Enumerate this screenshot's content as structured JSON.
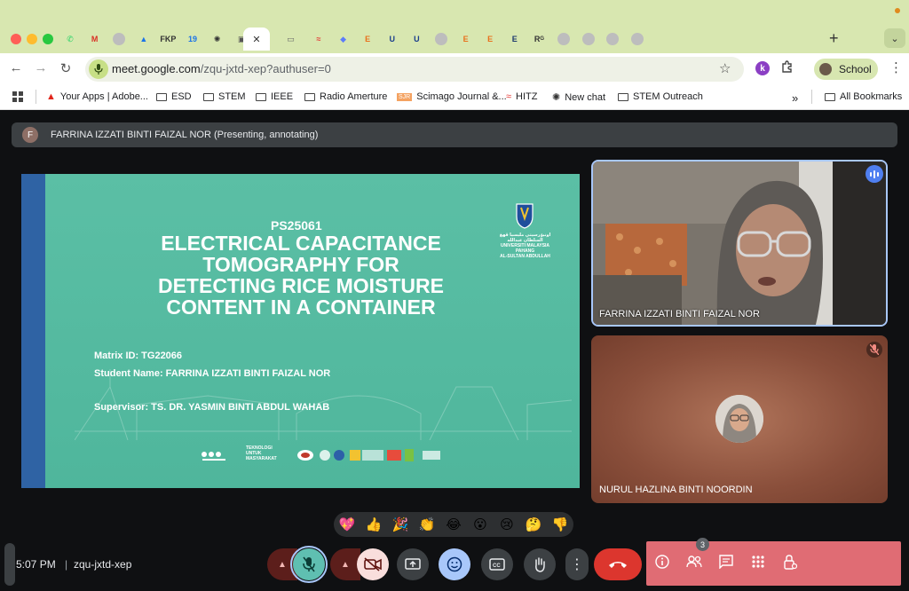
{
  "browser": {
    "tabs": [
      {
        "icon": "whatsapp-icon",
        "glyph": "✆",
        "color": "#25d366"
      },
      {
        "icon": "gmail-icon",
        "glyph": "M",
        "color": "#d93025"
      },
      {
        "icon": "generic-tab-icon",
        "glyph": "",
        "color": "#bdbdbd"
      },
      {
        "icon": "google-drive-icon",
        "glyph": "▲",
        "color": "#1a73e8"
      },
      {
        "icon": "fkp-tab-icon",
        "glyph": "FKP",
        "color": "#333333"
      },
      {
        "icon": "calendar-icon",
        "glyph": "19",
        "color": "#1a73e8"
      },
      {
        "icon": "chatgpt-icon",
        "glyph": "✺",
        "color": "#333333"
      },
      {
        "icon": "classroom-icon",
        "glyph": "▣",
        "color": "#555555"
      },
      {
        "icon": "gear-tab-icon",
        "glyph": "✹",
        "color": "#3b5998"
      },
      {
        "icon": "site-tab-icon",
        "glyph": "▭",
        "color": "#666666"
      },
      {
        "icon": "hitz-icon",
        "glyph": "≈",
        "color": "#e53935"
      },
      {
        "icon": "layers-icon",
        "glyph": "◆",
        "color": "#5c7cfa"
      },
      {
        "icon": "elsevier-icon",
        "glyph": "E",
        "color": "#e9711c"
      },
      {
        "icon": "ump-shield-icon",
        "glyph": "U",
        "color": "#1a3e8c"
      },
      {
        "icon": "ump-shield-icon",
        "glyph": "U",
        "color": "#1a3e8c"
      },
      {
        "icon": "generic-tab-icon",
        "glyph": "",
        "color": "#bdbdbd"
      },
      {
        "icon": "elsevier-icon",
        "glyph": "E",
        "color": "#e9711c"
      },
      {
        "icon": "elsevier-icon",
        "glyph": "E",
        "color": "#e9711c"
      },
      {
        "icon": "e-journal-icon",
        "glyph": "E",
        "color": "#1e3a6e"
      },
      {
        "icon": "researchgate-icon",
        "glyph": "Rᴳ",
        "color": "#333333"
      },
      {
        "icon": "generic-tab-icon",
        "glyph": "",
        "color": "#bdbdbd"
      },
      {
        "icon": "generic-tab-icon",
        "glyph": "",
        "color": "#bdbdbd"
      },
      {
        "icon": "generic-tab-icon",
        "glyph": "",
        "color": "#bdbdbd"
      },
      {
        "icon": "generic-tab-icon",
        "glyph": "",
        "color": "#bdbdbd"
      }
    ],
    "new_tab": "+",
    "url_host": "meet.google.com",
    "url_path": "/zqu-jxtd-xep?authuser=0",
    "profile_label": "School",
    "bookmarks": [
      {
        "label": "Your Apps | Adobe...",
        "icon": "adobe-icon"
      },
      {
        "label": "ESD",
        "icon": "folder-icon"
      },
      {
        "label": "STEM",
        "icon": "folder-icon"
      },
      {
        "label": "IEEE",
        "icon": "folder-icon"
      },
      {
        "label": "Radio Amerture",
        "icon": "folder-icon"
      },
      {
        "label": "Scimago Journal &...",
        "icon": "sjr-icon"
      },
      {
        "label": "HITZ",
        "icon": "hitz-icon"
      },
      {
        "label": "New chat",
        "icon": "chatgpt-icon"
      },
      {
        "label": "STEM Outreach",
        "icon": "folder-icon"
      }
    ],
    "bookmarks_overflow": "»",
    "all_bookmarks": "All Bookmarks"
  },
  "meet": {
    "presenter_initial": "F",
    "presenter_label": "FARRINA IZZATI BINTI FAIZAL NOR (Presenting, annotating)",
    "slide": {
      "code": "PS25061",
      "title_lines": [
        "ELECTRICAL CAPACITANCE",
        "TOMOGRAPHY FOR",
        "DETECTING RICE MOISTURE",
        "CONTENT IN A CONTAINER"
      ],
      "university": [
        "اونيۏرسيتي مليسيا ڤهڠ السلطان عبدالله",
        "UNIVERSITI MALAYSIA PAHANG",
        "AL-SULTAN ABDULLAH"
      ],
      "matrix": "Matrix ID: TG22066",
      "student": "Student Name: FARRINA IZZATI BINTI FAIZAL NOR",
      "supervisor": "Supervisor: TS. DR. YASMIN BINTI ABDUL WAHAB",
      "tagline": [
        "TEKNOLOGI",
        "UNTUK",
        "MASYARAKAT"
      ]
    },
    "participants": [
      {
        "name": "FARRINA IZZATI BINTI FAIZAL NOR",
        "speaking": true
      },
      {
        "name": "NURUL HAZLINA BINTI NOORDIN",
        "muted": true
      }
    ],
    "reactions": [
      "💖",
      "👍",
      "🎉",
      "👏",
      "😂",
      "😮",
      "😢",
      "🤔",
      "👎"
    ],
    "time": "5:07 PM",
    "divider": "|",
    "meeting_code": "zqu-jxtd-xep",
    "people_count": "3",
    "colors": {
      "accent": "#a8c7fa",
      "leave": "#dc362e",
      "panel": "#e06c74"
    }
  }
}
